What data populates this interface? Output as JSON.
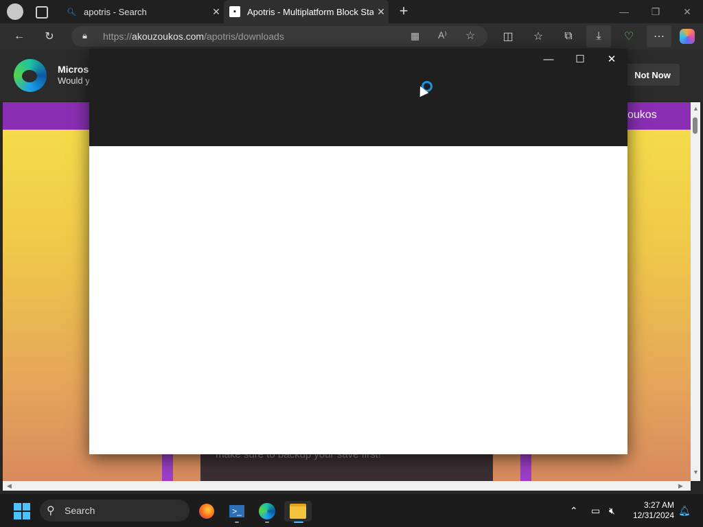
{
  "browser": {
    "tabs": [
      {
        "title": "apotris - Search",
        "icon": "search-icon"
      },
      {
        "title": "Apotris - Multiplatform Block Stac",
        "icon": "apotris-favicon"
      }
    ],
    "new_tab": "+",
    "url_prefix": "https://",
    "url_domain": "akouzoukos.com",
    "url_path": "/apotris/downloads"
  },
  "infobar": {
    "title": "Microso",
    "subtitle": "Would y",
    "not_now": "Not Now"
  },
  "site": {
    "brand_fragment": "oukos",
    "download_text": "make sure to backup your save first!"
  },
  "taskbar": {
    "search_label": "Search",
    "time": "3:27 AM",
    "date": "12/31/2024"
  },
  "colors": {
    "accent": "#1e90e6",
    "site_header": "#8a2fb3",
    "site_gradient_top": "#f6e04a",
    "site_gradient_bottom": "#d88a5e"
  }
}
